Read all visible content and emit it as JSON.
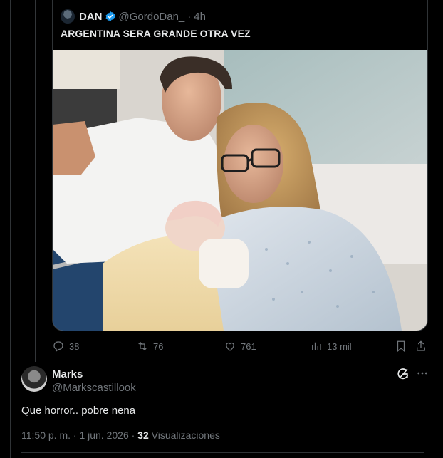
{
  "quoted_tweet": {
    "author_name": "DAN",
    "author_handle": "@GordoDan_",
    "separator": "·",
    "time": "4h",
    "text": "ARGENTINA SERA GRANDE OTRA VEZ",
    "media_icon": "photo"
  },
  "actions": {
    "replies": "38",
    "reposts": "76",
    "likes": "761",
    "views": "13 mil"
  },
  "reply": {
    "author_name": "Marks",
    "author_handle": "@Markscastillook",
    "text": "Que horror.. pobre nena",
    "timestamp": "11:50 p. m. · 1 jun. 2026 · ",
    "views_count": "32",
    "views_label": " Visualizaciones"
  },
  "icons": {
    "verified": "verified-badge-icon",
    "reply": "reply-icon",
    "repost": "repost-icon",
    "like": "heart-icon",
    "views": "views-icon",
    "bookmark": "bookmark-icon",
    "share": "share-icon",
    "grok": "grok-icon",
    "more": "more-icon"
  },
  "colors": {
    "background": "#000000",
    "text": "#e7e9ea",
    "muted": "#71767b",
    "border": "#2f3336",
    "verified": "#1d9bf0"
  }
}
